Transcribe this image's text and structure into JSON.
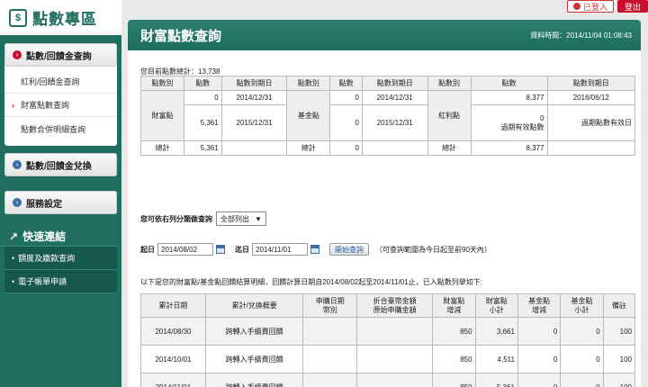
{
  "topbar": {
    "login_label": "已登入",
    "logout_label": "登出"
  },
  "sidebar": {
    "title": "點數專區",
    "logo_glyph": "$",
    "groups": [
      {
        "label": "點數/回饋金查詢",
        "items": [
          "紅利/回饋金查詢",
          "財富點數查詢",
          "點數合併明細查詢"
        ]
      },
      {
        "label": "點數/回饋金兌換"
      },
      {
        "label": "服務設定"
      }
    ],
    "quick_title": "快速連結",
    "quick_items": [
      "額度及繳款查詢",
      "電子帳單申請"
    ]
  },
  "main": {
    "title": "財富點數查詢",
    "data_time": "資料時間：2014/11/04 01:08:43",
    "total_points": "您目前點數總計：13,738"
  },
  "points_table": {
    "headers": [
      "點數別",
      "點數",
      "點數到期日",
      "點數別",
      "點數",
      "點數到期日",
      "點數別",
      "點數",
      "點數到期日"
    ],
    "type1": "財富點",
    "type2": "基金點",
    "type3": "紅利點",
    "r1": [
      "0",
      "2014/12/31",
      "0",
      "2014/12/31",
      "8,377",
      "2016/06/12"
    ],
    "r2": [
      "5,361",
      "2015/12/31",
      "0",
      "2015/12/31",
      "0",
      "過期有效點數",
      "過期點數有效日"
    ],
    "total_label": "總計",
    "totals": [
      "5,361",
      "0",
      "8,377"
    ]
  },
  "filter": {
    "label": "您可依右列分類做查詢",
    "selected": "全部列出"
  },
  "dates": {
    "from_label": "起日",
    "from": "2014/08/02",
    "to_label": "迄日",
    "to": "2014/11/01",
    "query_button": "開始查詢",
    "note": "（可查詢範圍為今日起至前90天內）"
  },
  "detail": {
    "desc": "以下是您的財富點/基金點回饋結算明細，回饋計算日期自2014/08/02起至2014/11/01止，已入點數列舉如下:",
    "headers": [
      [
        "累計日期"
      ],
      [
        "累計/兌換概要"
      ],
      [
        "申購日期",
        "幣別"
      ],
      [
        "折合臺幣金額",
        "原始申購金額"
      ],
      [
        "財富點",
        "增減"
      ],
      [
        "財富點",
        "小計"
      ],
      [
        "基金點",
        "增減"
      ],
      [
        "基金點",
        "小計"
      ],
      [
        "備註"
      ]
    ],
    "rows": [
      {
        "date": "2014/08/30",
        "summary": "跨轉入手續費回饋",
        "subdate": "",
        "amount": "",
        "wp_delta": "850",
        "wp_sub": "3,661",
        "fp_delta": "0",
        "fp_sub": "0",
        "note": "100"
      },
      {
        "date": "2014/10/01",
        "summary": "跨轉入手續費回饋",
        "subdate": "",
        "amount": "",
        "wp_delta": "850",
        "wp_sub": "4,511",
        "fp_delta": "0",
        "fp_sub": "0",
        "note": "100"
      },
      {
        "date": "2014/11/01",
        "summary": "跨轉入手續費回饋",
        "subdate": "",
        "amount": "",
        "wp_delta": "850",
        "wp_sub": "5,361",
        "fp_delta": "0",
        "fp_sub": "0",
        "note": "100"
      }
    ]
  }
}
